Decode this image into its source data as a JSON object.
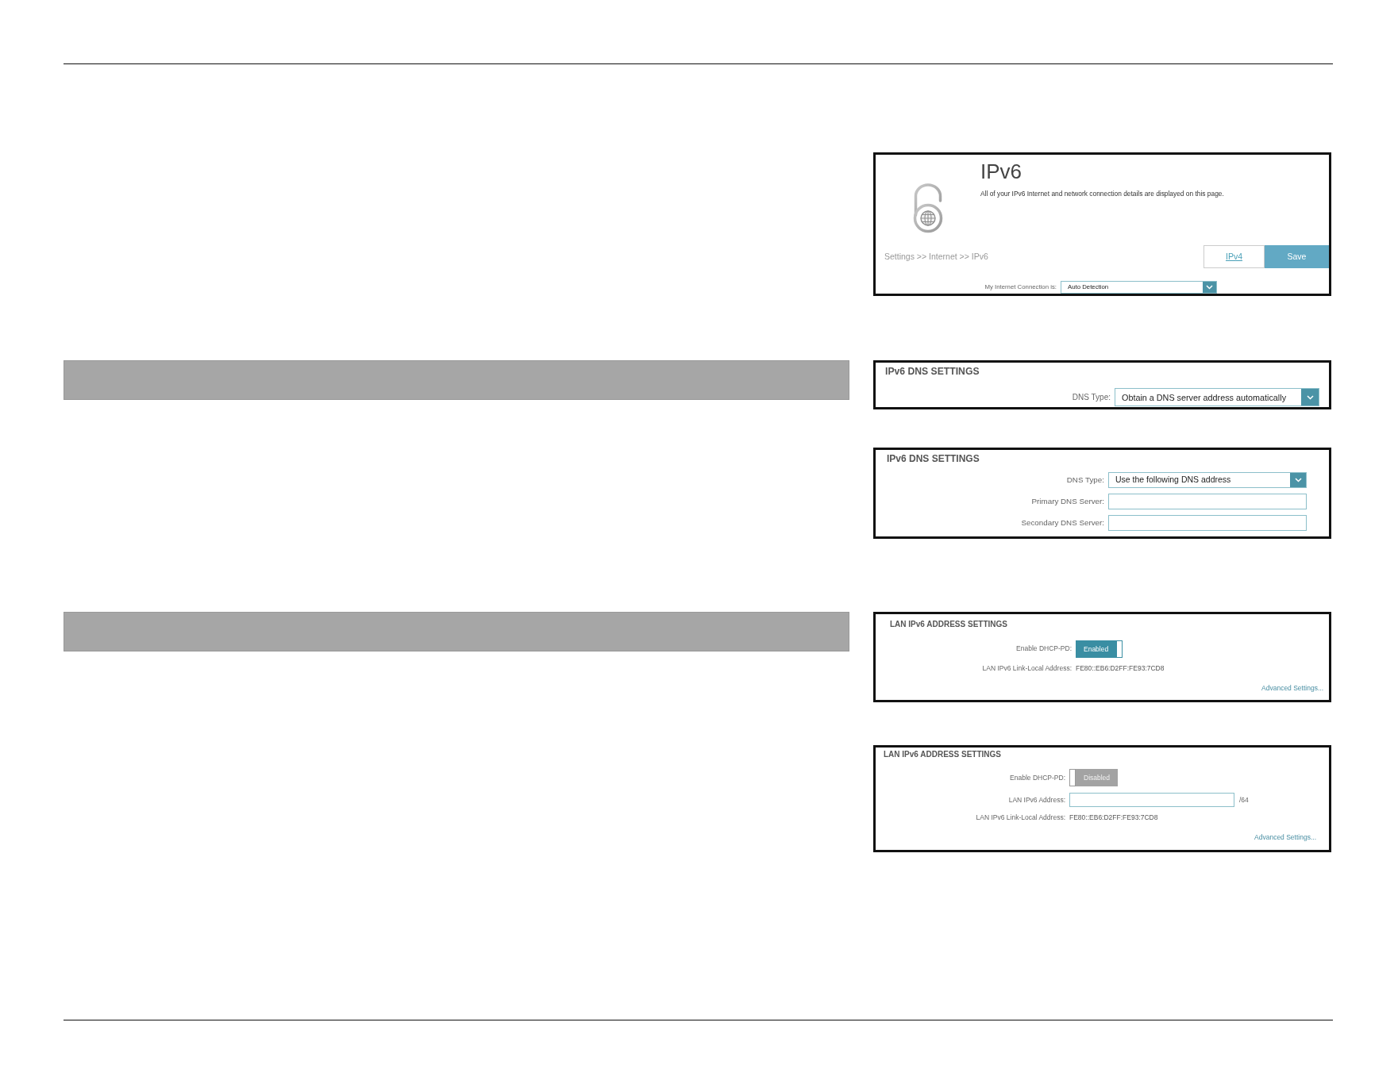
{
  "figures": [
    {
      "kind": "page_header",
      "section_bar": false,
      "title": "IPv6",
      "description": "All of your IPv6 Internet and network connection details are displayed on this page.",
      "breadcrumb": "Settings >> Internet >> IPv6",
      "buttons": [
        {
          "kind": "link",
          "label": "IPv4"
        },
        {
          "kind": "primary",
          "label": "Save"
        }
      ],
      "fields": [
        {
          "kind": "select",
          "label": "My Internet Connection is:",
          "value": "Auto Detection"
        }
      ]
    },
    {
      "kind": "settings",
      "section_bar": true,
      "title": "IPv6 DNS SETTINGS",
      "fields": [
        {
          "kind": "select",
          "label": "DNS Type:",
          "value": "Obtain a DNS server address automatically"
        }
      ]
    },
    {
      "kind": "settings",
      "section_bar": false,
      "title": "IPv6 DNS SETTINGS",
      "fields": [
        {
          "kind": "select",
          "label": "DNS Type:",
          "value": "Use the following DNS address"
        },
        {
          "kind": "input",
          "label": "Primary DNS Server:"
        },
        {
          "kind": "input",
          "label": "Secondary DNS Server:"
        }
      ]
    },
    {
      "kind": "settings",
      "section_bar": true,
      "title": "LAN IPv6 ADDRESS SETTINGS",
      "fields": [
        {
          "kind": "toggle",
          "label": "Enable DHCP-PD:",
          "on": true,
          "state_text": "Enabled"
        },
        {
          "kind": "text",
          "label": "LAN IPv6 Link-Local Address:",
          "value": "FE80::EB6:D2FF:FE93:7CD8"
        }
      ],
      "link": "Advanced Settings..."
    },
    {
      "kind": "settings",
      "section_bar": false,
      "title": "LAN IPv6 ADDRESS SETTINGS",
      "fields": [
        {
          "kind": "toggle",
          "label": "Enable DHCP-PD:",
          "on": false,
          "state_text": "Disabled"
        },
        {
          "kind": "input",
          "label": "LAN IPv6 Address:",
          "suffix": "/64"
        },
        {
          "kind": "text",
          "label": "LAN IPv6 Link-Local Address:",
          "value": "FE80::EB6:D2FF:FE93:7CD8"
        }
      ],
      "link": "Advanced Settings..."
    }
  ]
}
